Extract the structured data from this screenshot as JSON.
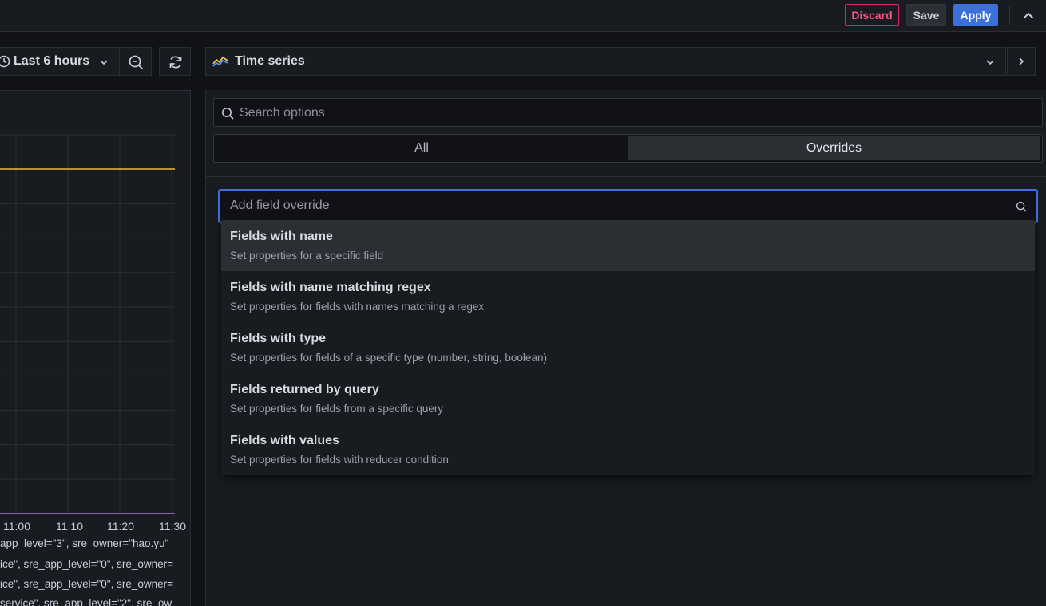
{
  "topbar": {
    "discard_label": "Discard",
    "save_label": "Save",
    "apply_label": "Apply"
  },
  "time_controls": {
    "range_label": "Last 6 hours"
  },
  "preview": {
    "x_ticks": [
      "11:00",
      "11:10",
      "11:20",
      "11:30"
    ],
    "legend": [
      "app_level=\"3\", sre_owner=\"hao.yu\"",
      "ice\", sre_app_level=\"0\", sre_owner=",
      "ice\", sre_app_level=\"0\", sre_owner=",
      "service\", sre_app_level=\"2\", sre_ow"
    ],
    "series_colors": [
      "#eab839",
      "#b877d9"
    ]
  },
  "viz_picker": {
    "label": "Time series"
  },
  "options": {
    "search_placeholder": "Search options",
    "tabs": [
      {
        "label": "All",
        "active": false
      },
      {
        "label": "Overrides",
        "active": true
      }
    ],
    "override_placeholder": "Add field override",
    "menu": [
      {
        "title": "Fields with name",
        "desc": "Set properties for a specific field",
        "active": true
      },
      {
        "title": "Fields with name matching regex",
        "desc": "Set properties for fields with names matching a regex",
        "active": false
      },
      {
        "title": "Fields with type",
        "desc": "Set properties for fields of a specific type (number, string, boolean)",
        "active": false
      },
      {
        "title": "Fields returned by query",
        "desc": "Set properties for fields from a specific query",
        "active": false
      },
      {
        "title": "Fields with values",
        "desc": "Set properties for fields with reducer condition",
        "active": false
      }
    ]
  },
  "colors": {
    "accent": "#3d71d9",
    "discard": "#e0226e",
    "background": "#111217",
    "panel": "#181b1f"
  }
}
